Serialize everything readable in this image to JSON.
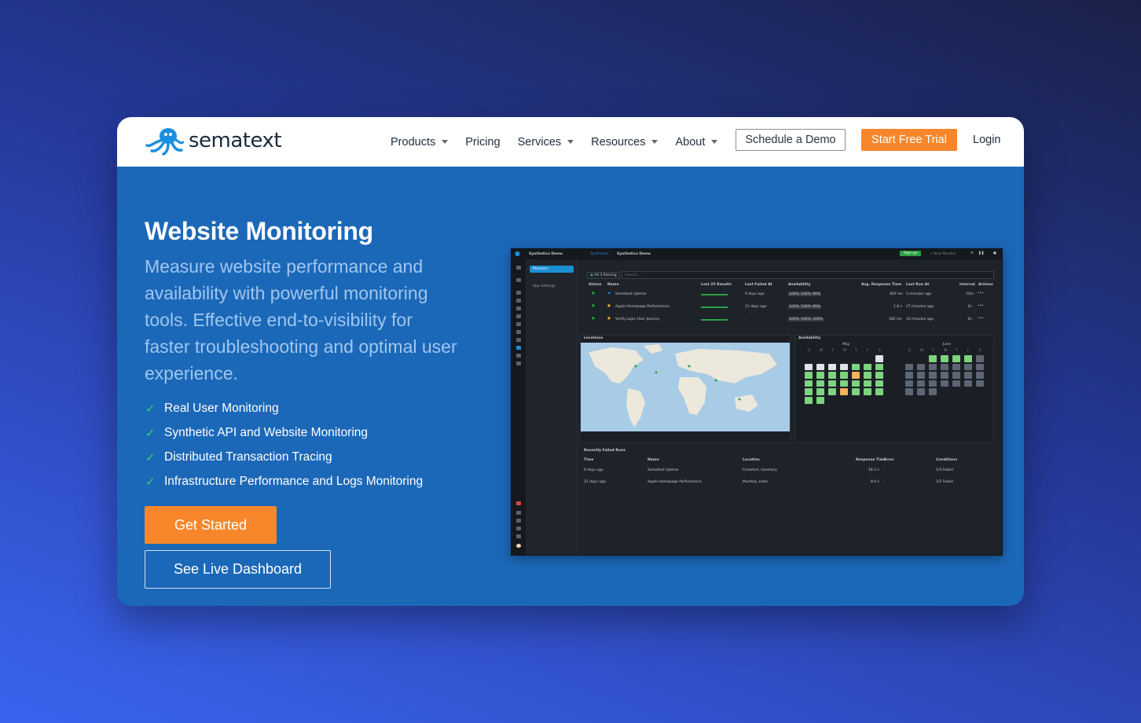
{
  "brand": {
    "name": "sematext"
  },
  "nav": {
    "items": [
      {
        "label": "Products",
        "dropdown": true
      },
      {
        "label": "Pricing",
        "dropdown": false
      },
      {
        "label": "Services",
        "dropdown": true
      },
      {
        "label": "Resources",
        "dropdown": true
      },
      {
        "label": "About",
        "dropdown": true
      }
    ],
    "schedule_demo": "Schedule a Demo",
    "start_trial": "Start Free Trial",
    "login": "Login"
  },
  "hero": {
    "title": "Website Monitoring",
    "subtitle": "Measure website performance and availability with powerful monitoring tools. Effective end-to-visibility for faster troubleshooting and optimal user experience.",
    "features": [
      "Real User Monitoring",
      "Synthetic API and Website Monitoring",
      "Distributed Transaction Tracing",
      "Infrastructure Performance and Logs Monitoring"
    ],
    "get_started": "Get Started",
    "live_dashboard": "See Live Dashboard"
  },
  "dashboard": {
    "app_name": "Synthetics Demo",
    "breadcrumb_root": "Synthetics",
    "breadcrumb_current": "Synthetics Demo",
    "signup": "Sign up",
    "new_monitor": "+ New Monitor",
    "side_monitors": "Monitors",
    "side_settings": "App Settings",
    "filter_all": "All 3 Passing",
    "search_placeholder": "Search...",
    "columns": [
      "Status",
      "Name",
      "Last 25 Results",
      "Last Failed At",
      "Availability",
      "Avg. Response Time",
      "Last Run At",
      "Interval",
      "Actions"
    ],
    "monitors": [
      {
        "name": "Sematext Uptime",
        "last_failed": "9 days ago",
        "availability": [
          "100%",
          "100%",
          "99%"
        ],
        "response": "463 ms",
        "last_run": "3 minutes ago",
        "interval": "10m"
      },
      {
        "name": "Apple Homepage Performance",
        "last_failed": "21 days ago",
        "availability": [
          "100%",
          "100%",
          "99%"
        ],
        "response": "1.8 s",
        "last_run": "27 minutes ago",
        "interval": "1h"
      },
      {
        "name": "Verify Login User Journey",
        "last_failed": "-",
        "availability": [
          "100%",
          "100%",
          "100%"
        ],
        "response": "382 ms",
        "last_run": "10 minutes ago",
        "interval": "1h"
      }
    ],
    "locations_title": "Locations",
    "availability_title": "Availability",
    "month1": "May",
    "month2": "June",
    "weekdays": [
      "S",
      "M",
      "T",
      "W",
      "T",
      "F",
      "S"
    ],
    "failed_title": "Recently Failed Runs",
    "failed_columns": [
      "Time",
      "Name",
      "Location",
      "Response Time",
      "Error",
      "Conditions"
    ],
    "failed_runs": [
      {
        "time": "9 days ago",
        "name": "Sematext Uptime",
        "location": "Frankfurt, Germany",
        "response": "18.3 s",
        "error": "-",
        "conditions": "1/3 Failed"
      },
      {
        "time": "21 days ago",
        "name": "Apple Homepage Performance",
        "location": "Mumbai, India",
        "response": "8.0 s",
        "error": "-",
        "conditions": "1/2 Failed"
      }
    ]
  },
  "colors": {
    "accent_orange": "#f7872a",
    "hero_blue": "#1c68b8",
    "check_green": "#2fd17a"
  }
}
